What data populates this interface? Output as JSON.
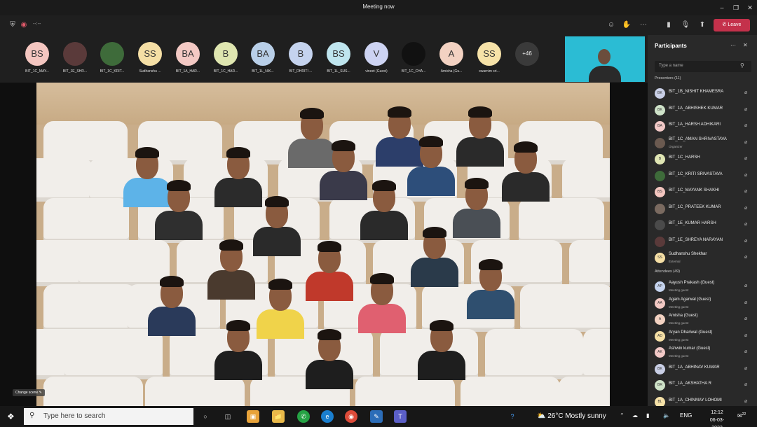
{
  "window": {
    "title": "Meeting now"
  },
  "toolbar": {
    "timer": "--:--",
    "leave_label": "Leave"
  },
  "strip": {
    "avatars": [
      {
        "initials": "BS",
        "name": "BIT_1C_MAY...",
        "color": "#f4c6c0"
      },
      {
        "initials": "",
        "name": "BIT_1E_SHR...",
        "color": "#5a3a3a"
      },
      {
        "initials": "",
        "name": "BIT_1C_KRIT...",
        "color": "#3e6b3a"
      },
      {
        "initials": "SS",
        "name": "Sudhanshu ...",
        "color": "#f5dfa5"
      },
      {
        "initials": "BA",
        "name": "BIT_1A_HAR...",
        "color": "#f3c9c4"
      },
      {
        "initials": "B",
        "name": "BIT_1C_HAR...",
        "color": "#dfe6b0"
      },
      {
        "initials": "BA",
        "name": "BIT_1L_NIK...",
        "color": "#b9cfe8"
      },
      {
        "initials": "B",
        "name": "BIT_DHRITI ...",
        "color": "#c5d3ee"
      },
      {
        "initials": "BS",
        "name": "BIT_1L_SUS...",
        "color": "#bfe5ee"
      },
      {
        "initials": "V",
        "name": "vineet (Guest)",
        "color": "#cdd3f2"
      },
      {
        "initials": "",
        "name": "BIT_1C_CHA...",
        "color": "#111111"
      },
      {
        "initials": "A",
        "name": "Amisha (Gu...",
        "color": "#f3d2c2"
      },
      {
        "initials": "SS",
        "name": "swarnim sri...",
        "color": "#f6e2a8"
      }
    ],
    "more_count": "+46"
  },
  "stage": {
    "change_scene_label": "Change scene"
  },
  "panel": {
    "title": "Participants",
    "search_placeholder": "Type a name",
    "presenters_header": "Presenters (11)",
    "attendees_header": "Attendees (49)",
    "presenters": [
      {
        "initials": "BK",
        "name": "BIT_1B_NISHIT KHAMESRA",
        "sub": "",
        "color": "#c9cfe6"
      },
      {
        "initials": "BK",
        "name": "BIT_1A_ABHISHEK KUMAR",
        "sub": "",
        "color": "#cfe3c9"
      },
      {
        "initials": "BA",
        "name": "BIT_1A_HARSH ADHIKARI",
        "sub": "",
        "color": "#f2c9c7"
      },
      {
        "initials": "",
        "name": "BIT_1C_AMAN SHRIVASTAVA",
        "sub": "Organizer",
        "color": "#6b5a50"
      },
      {
        "initials": "B",
        "name": "BIT_1C_HARSH",
        "sub": "",
        "color": "#e0e6b4"
      },
      {
        "initials": "",
        "name": "BIT_1C_KRITI SRIVASTAVA",
        "sub": "",
        "color": "#3e6b3a"
      },
      {
        "initials": "BS",
        "name": "BIT_1C_MAYANK SHAKHI",
        "sub": "",
        "color": "#f4c6c0"
      },
      {
        "initials": "",
        "name": "BIT_1C_PRATEEK KUMAR",
        "sub": "",
        "color": "#7a6a60"
      },
      {
        "initials": "",
        "name": "BIT_1E_KUMAR HARSH",
        "sub": "",
        "color": "#4a4a4a"
      },
      {
        "initials": "",
        "name": "BIT_1E_SHREYA NARAYAN",
        "sub": "",
        "color": "#5a3a3a"
      },
      {
        "initials": "SS",
        "name": "Sudhanshu Shekhar",
        "sub": "External",
        "color": "#f5dfa5"
      }
    ],
    "attendees": [
      {
        "initials": "AP",
        "name": "Aayush Prakash (Guest)",
        "sub": "Meeting guest",
        "color": "#c5d3ee"
      },
      {
        "initials": "AA",
        "name": "Agam Agarwal (Guest)",
        "sub": "Meeting guest",
        "color": "#f3c9c4"
      },
      {
        "initials": "A",
        "name": "Amisha (Guest)",
        "sub": "Meeting guest",
        "color": "#f3d2c2"
      },
      {
        "initials": "AD",
        "name": "Aryan Dhariwal (Guest)",
        "sub": "Meeting guest",
        "color": "#f5dfa5"
      },
      {
        "initials": "AK",
        "name": "Ashwin kumar (Guest)",
        "sub": "Meeting guest",
        "color": "#f2c9c7"
      },
      {
        "initials": "BK",
        "name": "BIT_1A_ABHINAV KUMAR",
        "sub": "",
        "color": "#c9cfe6"
      },
      {
        "initials": "BR",
        "name": "BIT_1A_AKSHATHA R",
        "sub": "",
        "color": "#cfe3c9"
      },
      {
        "initials": "BL",
        "name": "BIT_1A_CHINMAY LOHOMI",
        "sub": "",
        "color": "#f6e2a8"
      }
    ]
  },
  "taskbar": {
    "search_placeholder": "Type here to search",
    "weather": "26°C  Mostly sunny",
    "language": "ENG",
    "time": "12:12",
    "date": "06-03-2022",
    "notifications": "22"
  }
}
